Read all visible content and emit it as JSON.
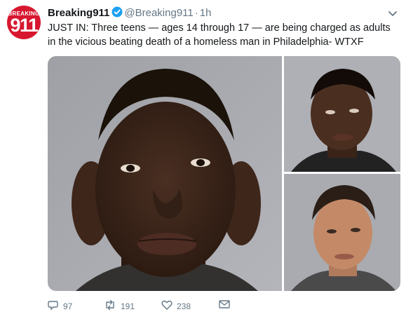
{
  "tweet": {
    "avatar_top": "BREAKING",
    "avatar_bottom": "911",
    "display_name": "Breaking911",
    "handle": "@Breaking911",
    "separator": "·",
    "time": "1h",
    "text": "JUST IN: Three teens — ages 14 through 17 — are being charged as adults in the vicious beating death of a homeless man in Philadelphia- WTXF"
  },
  "actions": {
    "reply_count": "97",
    "retweet_count": "191",
    "like_count": "238"
  },
  "colors": {
    "brand_red": "#d7172f",
    "verified_blue": "#1da1f2",
    "secondary_text": "#657786"
  },
  "icons": [
    "verified-badge-icon",
    "chevron-down-icon",
    "reply-icon",
    "retweet-icon",
    "like-icon",
    "direct-message-icon"
  ]
}
